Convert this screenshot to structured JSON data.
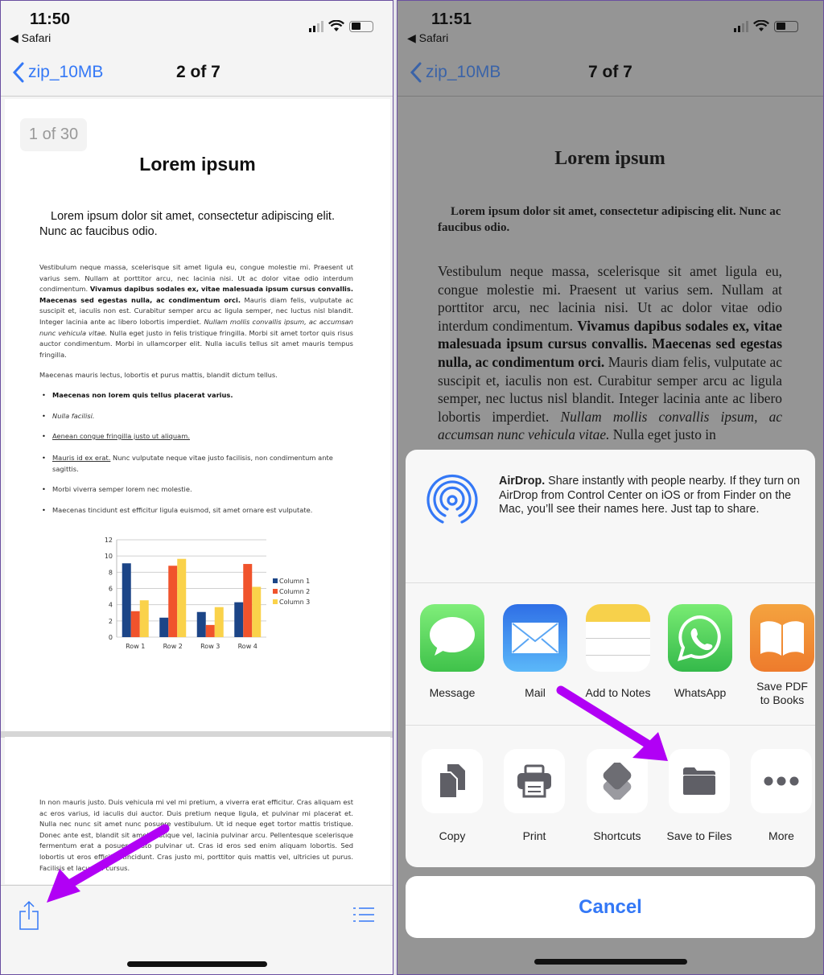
{
  "left": {
    "status": {
      "time": "11:50",
      "back_app": "Safari"
    },
    "nav": {
      "back_label": "zip_10MB",
      "title": "2 of 7"
    },
    "page_badge": "1 of 30",
    "doc": {
      "title": "Lorem ipsum",
      "subtitle": "Lorem ipsum dolor sit amet, consectetur adipiscing elit. Nunc ac faucibus odio.",
      "para1": [
        {
          "t": "Vestibulum neque massa, scelerisque sit amet ligula eu, congue molestie mi. Praesent ut varius sem. Nullam at porttitor arcu, nec lacinia nisi. Ut ac dolor vitae odio interdum condimentum. ",
          "s": ""
        },
        {
          "t": "Vivamus dapibus sodales ex, vitae malesuada ipsum cursus convallis. Maecenas sed egestas nulla, ac condimentum orci.",
          "s": "bd"
        },
        {
          "t": " Mauris diam felis, vulputate ac suscipit et, iaculis non est. Curabitur semper arcu ac ligula semper, nec luctus nisl blandit. Integer lacinia ante ac libero lobortis imperdiet. ",
          "s": ""
        },
        {
          "t": "Nullam mollis convallis ipsum, ac accumsan nunc vehicula vitae.",
          "s": "it"
        },
        {
          "t": " Nulla eget justo in felis tristique fringilla. Morbi sit amet tortor quis risus auctor condimentum. Morbi in ullamcorper elit. Nulla iaculis tellus sit amet mauris tempus fringilla.",
          "s": ""
        }
      ],
      "para2": "Maecenas mauris lectus, lobortis et purus mattis, blandit dictum tellus.",
      "bullets": [
        [
          {
            "t": "Maecenas non lorem quis tellus placerat varius.",
            "s": "bd"
          }
        ],
        [
          {
            "t": "Nulla facilisi.",
            "s": "it"
          }
        ],
        [
          {
            "t": "Aenean congue fringilla justo ut aliquam.",
            "s": "u"
          }
        ],
        [
          {
            "t": "Mauris id ex erat.",
            "s": "u"
          },
          {
            "t": " Nunc vulputate neque vitae justo facilisis, non condimentum ante sagittis.",
            "s": ""
          }
        ],
        [
          {
            "t": "Morbi viverra semper lorem nec molestie.",
            "s": ""
          }
        ],
        [
          {
            "t": "Maecenas tincidunt est efficitur ligula euismod, sit amet ornare est vulputate.",
            "s": ""
          }
        ]
      ],
      "page2_para": "In non mauris justo. Duis vehicula mi vel mi pretium, a viverra erat efficitur. Cras aliquam est ac eros varius, id iaculis dui auctor. Duis pretium neque ligula, et pulvinar mi placerat et. Nulla nec nunc sit amet nunc posuere vestibulum. Ut id neque eget tortor mattis tristique. Donec ante est, blandit sit amet tristique vel, lacinia pulvinar arcu. Pellentesque scelerisque fermentum erat a posuere justo pulvinar ut. Cras id eros sed enim aliquam lobortis. Sed lobortis ut eros efficitur tincidunt. Cras justo mi, porttitor quis mattis vel, ultricies ut purus. Facilisis et lacus eu cursus."
    },
    "toolbar": {
      "share_icon": "share-icon",
      "list_icon": "list-icon"
    }
  },
  "chart_data": {
    "type": "bar",
    "categories": [
      "Row 1",
      "Row 2",
      "Row 3",
      "Row 4"
    ],
    "series": [
      {
        "name": "Column 1",
        "values": [
          9.1,
          2.4,
          3.1,
          4.3
        ],
        "color": "#1c4587"
      },
      {
        "name": "Column 2",
        "values": [
          3.2,
          8.8,
          1.5,
          9.02
        ],
        "color": "#f0532c"
      },
      {
        "name": "Column 3",
        "values": [
          4.54,
          9.65,
          3.7,
          6.2
        ],
        "color": "#fad24a"
      }
    ],
    "yticks": [
      "0",
      "2",
      "4",
      "6",
      "8",
      "10",
      "12"
    ],
    "ylim": [
      0,
      12
    ],
    "grid": true,
    "legend": "right"
  },
  "right": {
    "status": {
      "time": "11:51",
      "back_app": "Safari"
    },
    "nav": {
      "back_label": "zip_10MB",
      "title": "7 of 7"
    },
    "doc": {
      "title": "Lorem ipsum",
      "subtitle": "Lorem ipsum dolor sit amet, consectetur adipiscing elit. Nunc ac faucibus odio.",
      "para1": [
        {
          "t": "Vestibulum neque massa, scelerisque sit amet ligula eu, congue molestie mi. Praesent ut varius sem. Nullam at porttitor arcu, nec lacinia nisi. Ut ac dolor vitae odio interdum condimentum. ",
          "s": ""
        },
        {
          "t": "Vivamus dapibus sodales ex, vitae malesuada ipsum cursus convallis. Maecenas sed egestas nulla, ac condimentum orci.",
          "s": "bd"
        },
        {
          "t": " Mauris diam felis, vulputate ac suscipit et, iaculis non est. Curabitur semper arcu ac ligula semper, nec luctus nisl blandit. Integer lacinia ante ac libero lobortis imperdiet. ",
          "s": ""
        },
        {
          "t": "Nullam mollis convallis ipsum, ac accumsan nunc vehicula vitae.",
          "s": "it"
        },
        {
          "t": " Nulla eget justo in",
          "s": ""
        }
      ]
    },
    "share_sheet": {
      "airdrop_title": "AirDrop.",
      "airdrop_text": " Share instantly with people nearby. If they turn on AirDrop from Control Center on iOS or from Finder on the Mac, you’ll see their names here. Just tap to share.",
      "apps": [
        {
          "label": "Message",
          "icon": "message-icon"
        },
        {
          "label": "Mail",
          "icon": "mail-icon"
        },
        {
          "label": "Add to Notes",
          "icon": "notes-icon"
        },
        {
          "label": "WhatsApp",
          "icon": "whatsapp-icon"
        },
        {
          "label": "Save PDF to Books",
          "icon": "books-icon"
        }
      ],
      "actions": [
        {
          "label": "Copy",
          "icon": "copy-icon"
        },
        {
          "label": "Print",
          "icon": "print-icon"
        },
        {
          "label": "Shortcuts",
          "icon": "shortcuts-icon"
        },
        {
          "label": "Save to Files",
          "icon": "folder-icon"
        },
        {
          "label": "More",
          "icon": "more-icon"
        }
      ],
      "cancel_label": "Cancel"
    }
  },
  "colors": {
    "accent": "#3478f6",
    "annotation_arrow": "#b100f5"
  }
}
